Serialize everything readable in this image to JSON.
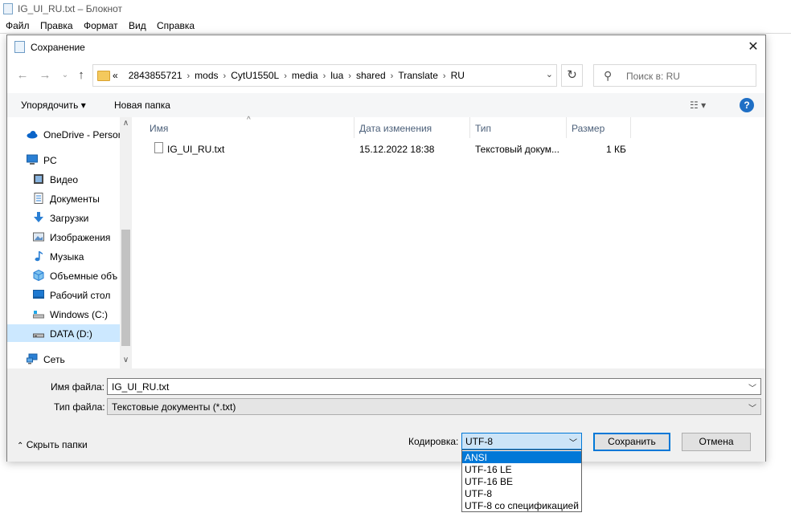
{
  "notepad": {
    "title": "IG_UI_RU.txt – Блокнот",
    "menu": [
      "Файл",
      "Правка",
      "Формат",
      "Вид",
      "Справка"
    ]
  },
  "dialog": {
    "title": "Сохранение",
    "close": "✕",
    "breadcrumb": {
      "overflow": "«",
      "parts": [
        "2843855721",
        "mods",
        "CytU1550L",
        "media",
        "lua",
        "shared",
        "Translate",
        "RU"
      ]
    },
    "search_placeholder": "Поиск в: RU",
    "toolbar": {
      "organize": "Упорядочить ▾",
      "new_folder": "Новая папка",
      "help": "?"
    },
    "nav": [
      {
        "label": "OneDrive - Person",
        "icon": "onedrive-icon"
      },
      {
        "label": "PC",
        "icon": "computer-icon"
      },
      {
        "label": "Видео",
        "icon": "video-icon"
      },
      {
        "label": "Документы",
        "icon": "documents-icon"
      },
      {
        "label": "Загрузки",
        "icon": "downloads-icon"
      },
      {
        "label": "Изображения",
        "icon": "pictures-icon"
      },
      {
        "label": "Музыка",
        "icon": "music-icon"
      },
      {
        "label": "Объемные объ",
        "icon": "3d-objects-icon"
      },
      {
        "label": "Рабочий стол",
        "icon": "desktop-icon"
      },
      {
        "label": "Windows (C:)",
        "icon": "drive-c-icon"
      },
      {
        "label": "DATA (D:)",
        "icon": "drive-d-icon",
        "selected": true
      },
      {
        "label": "Сеть",
        "icon": "network-icon"
      }
    ],
    "columns": [
      "Имя",
      "Дата изменения",
      "Тип",
      "Размер"
    ],
    "files": [
      {
        "name": "IG_UI_RU.txt",
        "modified": "15.12.2022 18:38",
        "type": "Текстовый докум...",
        "size": "1 КБ"
      }
    ],
    "filename_label": "Имя файла:",
    "filename_value": "IG_UI_RU.txt",
    "filetype_label": "Тип файла:",
    "filetype_value": "Текстовые документы (*.txt)",
    "hide_folders": "Скрыть папки",
    "encoding_label": "Кодировка:",
    "encoding_value": "UTF-8",
    "save_button": "Сохранить",
    "cancel_button": "Отмена",
    "encoding_options": [
      "ANSI",
      "UTF-16 LE",
      "UTF-16 BE",
      "UTF-8",
      "UTF-8 со спецификацией"
    ],
    "encoding_highlighted": "ANSI"
  },
  "colors": {
    "accent": "#0078d7",
    "selected_bg": "#cce8ff",
    "folder": "#f4c95d"
  }
}
